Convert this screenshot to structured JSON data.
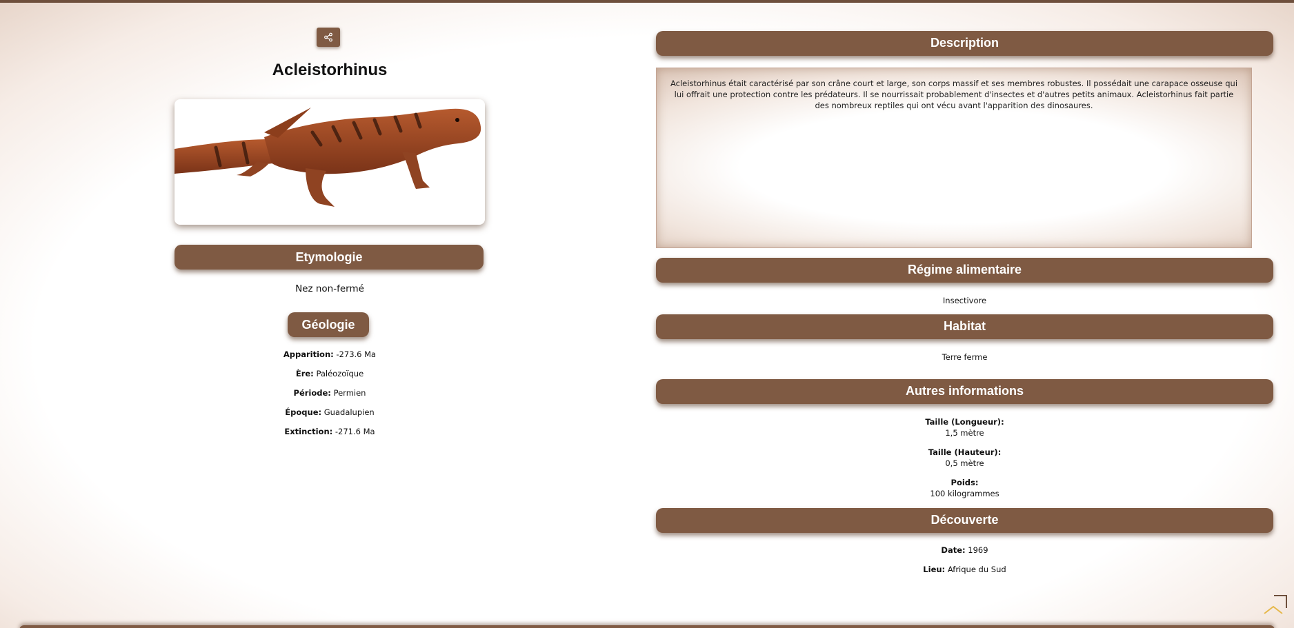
{
  "title": "Acleistorhinus",
  "icons": {
    "share": "share-icon",
    "scroll_top": "chevron-up-icon"
  },
  "colors": {
    "header_bg": "#7f5a43",
    "accent": "#e6b84a"
  },
  "etymology": {
    "heading": "Etymologie",
    "value": "Nez non-fermé"
  },
  "geology": {
    "heading": "Géologie",
    "rows": [
      {
        "label": "Apparition:",
        "value": "-273.6 Ma"
      },
      {
        "label": "Ère:",
        "value": "Paléozoïque"
      },
      {
        "label": "Période:",
        "value": "Permien"
      },
      {
        "label": "Époque:",
        "value": "Guadalupien"
      },
      {
        "label": "Extinction:",
        "value": "-271.6 Ma"
      }
    ]
  },
  "description": {
    "heading": "Description",
    "text": "Acleistorhinus était caractérisé par son crâne court et large, son corps massif et ses membres robustes. Il possédait une carapace osseuse qui lui offrait une protection contre les prédateurs. Il se nourrissait probablement d'insectes et d'autres petits animaux. Acleistorhinus fait partie des nombreux reptiles qui ont vécu avant l'apparition des dinosaures."
  },
  "diet": {
    "heading": "Régime alimentaire",
    "value": "Insectivore"
  },
  "habitat": {
    "heading": "Habitat",
    "value": "Terre ferme"
  },
  "other": {
    "heading": "Autres informations",
    "rows": [
      {
        "label": "Taille (Longueur):",
        "value": "1,5 mètre"
      },
      {
        "label": "Taille (Hauteur):",
        "value": "0,5 mètre"
      },
      {
        "label": "Poids:",
        "value": "100 kilogrammes"
      }
    ]
  },
  "discovery": {
    "heading": "Découverte",
    "rows": [
      {
        "label": "Date:",
        "value": "1969"
      },
      {
        "label": "Lieu:",
        "value": "Afrique du Sud"
      }
    ]
  }
}
